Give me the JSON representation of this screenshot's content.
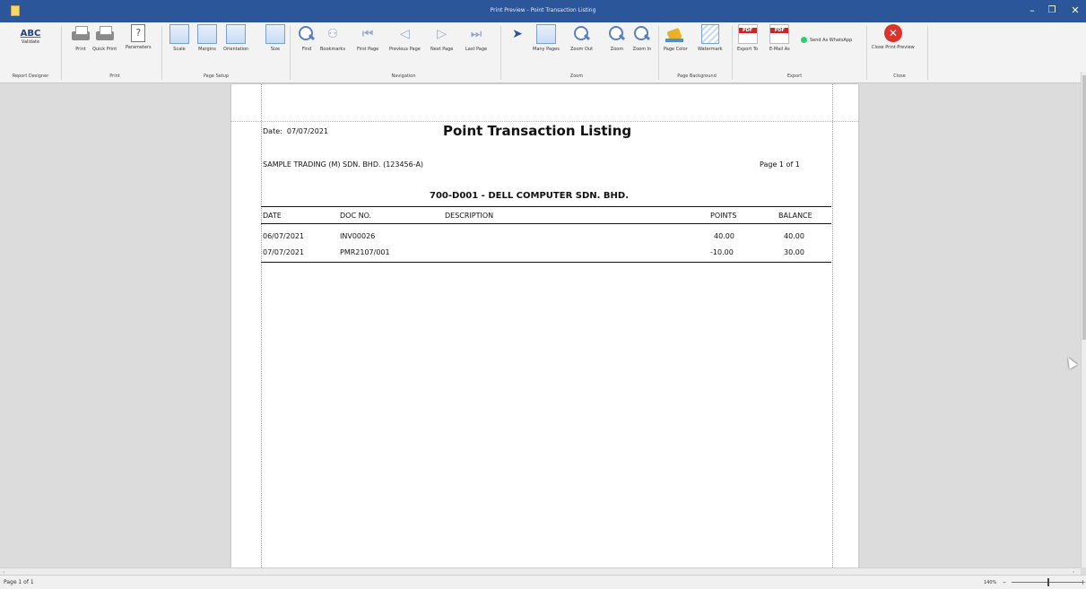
{
  "window": {
    "title": "Print Preview - Point Transaction Listing",
    "controls": {
      "minimize": "–",
      "maximize": "❐",
      "close": "✕"
    }
  },
  "ribbon": {
    "report_designer": {
      "button": "Validate",
      "group": "Report Designer"
    },
    "print": {
      "buttons": [
        "Print",
        "Quick Print",
        "Parameters"
      ],
      "group": "Print"
    },
    "page_setup": {
      "buttons": [
        "Scale",
        "Margins",
        "Orientation",
        "Size"
      ],
      "group": "Page Setup"
    },
    "navigation": {
      "buttons": [
        "Find",
        "Bookmarks",
        "First Page",
        "Previous Page",
        "Next Page",
        "Last Page"
      ],
      "group": "Navigation"
    },
    "zoom": {
      "buttons": [
        "Many Pages",
        "Zoom Out",
        "Zoom",
        "Zoom In"
      ],
      "group": "Zoom"
    },
    "page_background": {
      "buttons": [
        "Page Color",
        "Watermark"
      ],
      "group": "Page Background"
    },
    "export": {
      "buttons": [
        "Export To",
        "E-Mail As",
        "Send As WhatsApp"
      ],
      "group": "Export"
    },
    "close": {
      "button": "Close Print Preview",
      "group": "Close"
    }
  },
  "report": {
    "date_label": "Date:",
    "date_value": "07/07/2021",
    "title": "Point Transaction Listing",
    "company": "SAMPLE TRADING (M) SDN. BHD. (123456-A)",
    "page_info": "Page 1 of 1",
    "account": "700-D001 - DELL COMPUTER SDN. BHD.",
    "columns": [
      "DATE",
      "DOC NO.",
      "DESCRIPTION",
      "POINTS",
      "BALANCE"
    ],
    "rows": [
      {
        "date": "06/07/2021",
        "doc_no": "INV00026",
        "description": "",
        "points": "40.00",
        "balance": "40.00"
      },
      {
        "date": "07/07/2021",
        "doc_no": "PMR2107/001",
        "description": "",
        "points": "-10.00",
        "balance": "30.00"
      }
    ]
  },
  "status": {
    "page": "Page 1 of 1",
    "zoom": "140%",
    "zoom_out": "–",
    "zoom_in": "+"
  },
  "colors": {
    "titlebar": "#2b579a",
    "ribbon": "#f3f3f3",
    "workspace": "#dcdcdc"
  }
}
